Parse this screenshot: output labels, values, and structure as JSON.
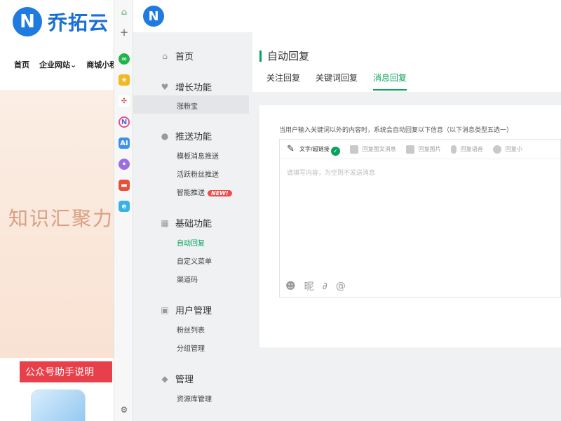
{
  "background_site": {
    "logo_text": "乔拓云",
    "nav": [
      "首页",
      "企业网站⌄",
      "商城小程序"
    ],
    "hero_text": "知识汇聚力",
    "help_label": "公众号助手说明"
  },
  "sidebar": {
    "home": "首页",
    "groups": [
      {
        "label": "增长功能",
        "items": [
          "涨粉宝"
        ]
      },
      {
        "label": "推送功能",
        "items": [
          "模板消息推送",
          "活跃粉丝推送",
          "智能推送"
        ]
      },
      {
        "label": "基础功能",
        "items": [
          "自动回复",
          "自定义菜单",
          "渠道码"
        ]
      },
      {
        "label": "用户管理",
        "items": [
          "粉丝列表",
          "分组管理"
        ]
      },
      {
        "label": "管理",
        "items": [
          "资源库管理"
        ]
      }
    ],
    "new_badge": "NEW!"
  },
  "content": {
    "title": "自动回复",
    "tabs": [
      "关注回复",
      "关键词回复",
      "消息回复"
    ],
    "active_tab": "消息回复",
    "hint": "当用户输入关键词以外的内容时，系统会自动回复以下信息（以下消息类型五选一）",
    "toolbar": [
      "文字/超链接",
      "回复图文消息",
      "回复图片",
      "回复语音",
      "回复小"
    ],
    "placeholder": "请填写内容，为空则不发送消息",
    "bottom_icons": [
      "emoji-icon",
      "nickname-icon",
      "link-icon",
      "attachment-icon"
    ],
    "bottom_nickname_label": "昵"
  },
  "colors": {
    "accent": "#07a35a",
    "brand": "#1f7be0",
    "badge": "#f04a4a"
  }
}
